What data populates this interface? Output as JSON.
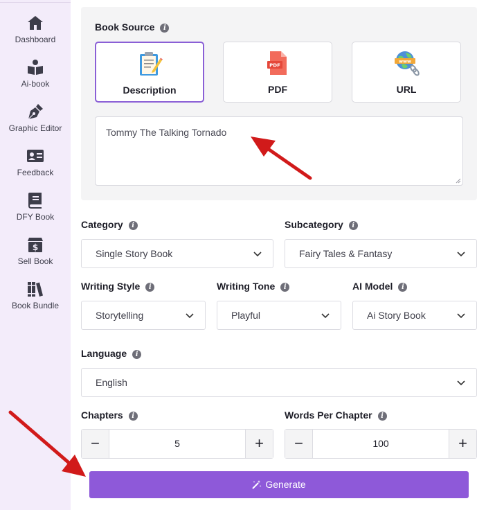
{
  "sidebar": {
    "items": [
      {
        "label": "Dashboard",
        "icon": "home-icon"
      },
      {
        "label": "Ai-book",
        "icon": "reader-icon"
      },
      {
        "label": "Graphic Editor",
        "icon": "pen-nib-icon"
      },
      {
        "label": "Feedback",
        "icon": "id-card-icon"
      },
      {
        "label": "DFY Book",
        "icon": "book-icon"
      },
      {
        "label": "Sell Book",
        "icon": "dollar-box-icon"
      },
      {
        "label": "Book Bundle",
        "icon": "books-icon"
      }
    ]
  },
  "book_source": {
    "title": "Book Source",
    "options": [
      {
        "label": "Description",
        "icon": "clipboard-icon",
        "active": true
      },
      {
        "label": "PDF",
        "icon": "pdf-file-icon",
        "active": false
      },
      {
        "label": "URL",
        "icon": "globe-link-icon",
        "active": false
      }
    ],
    "description_value": "Tommy The Talking Tornado"
  },
  "fields": {
    "category": {
      "label": "Category",
      "value": "Single Story Book"
    },
    "subcategory": {
      "label": "Subcategory",
      "value": "Fairy Tales & Fantasy"
    },
    "writing_style": {
      "label": "Writing Style",
      "value": "Storytelling"
    },
    "writing_tone": {
      "label": "Writing Tone",
      "value": "Playful"
    },
    "ai_model": {
      "label": "AI Model",
      "value": "Ai Story Book"
    },
    "language": {
      "label": "Language",
      "value": "English"
    },
    "chapters": {
      "label": "Chapters",
      "value": "5"
    },
    "words_per_chapter": {
      "label": "Words Per Chapter",
      "value": "100"
    }
  },
  "generate": {
    "label": "Generate"
  },
  "colors": {
    "accent": "#8e59d9",
    "annotation_arrow": "#d11a1a",
    "sidebar_bg": "#f3ecfa"
  }
}
